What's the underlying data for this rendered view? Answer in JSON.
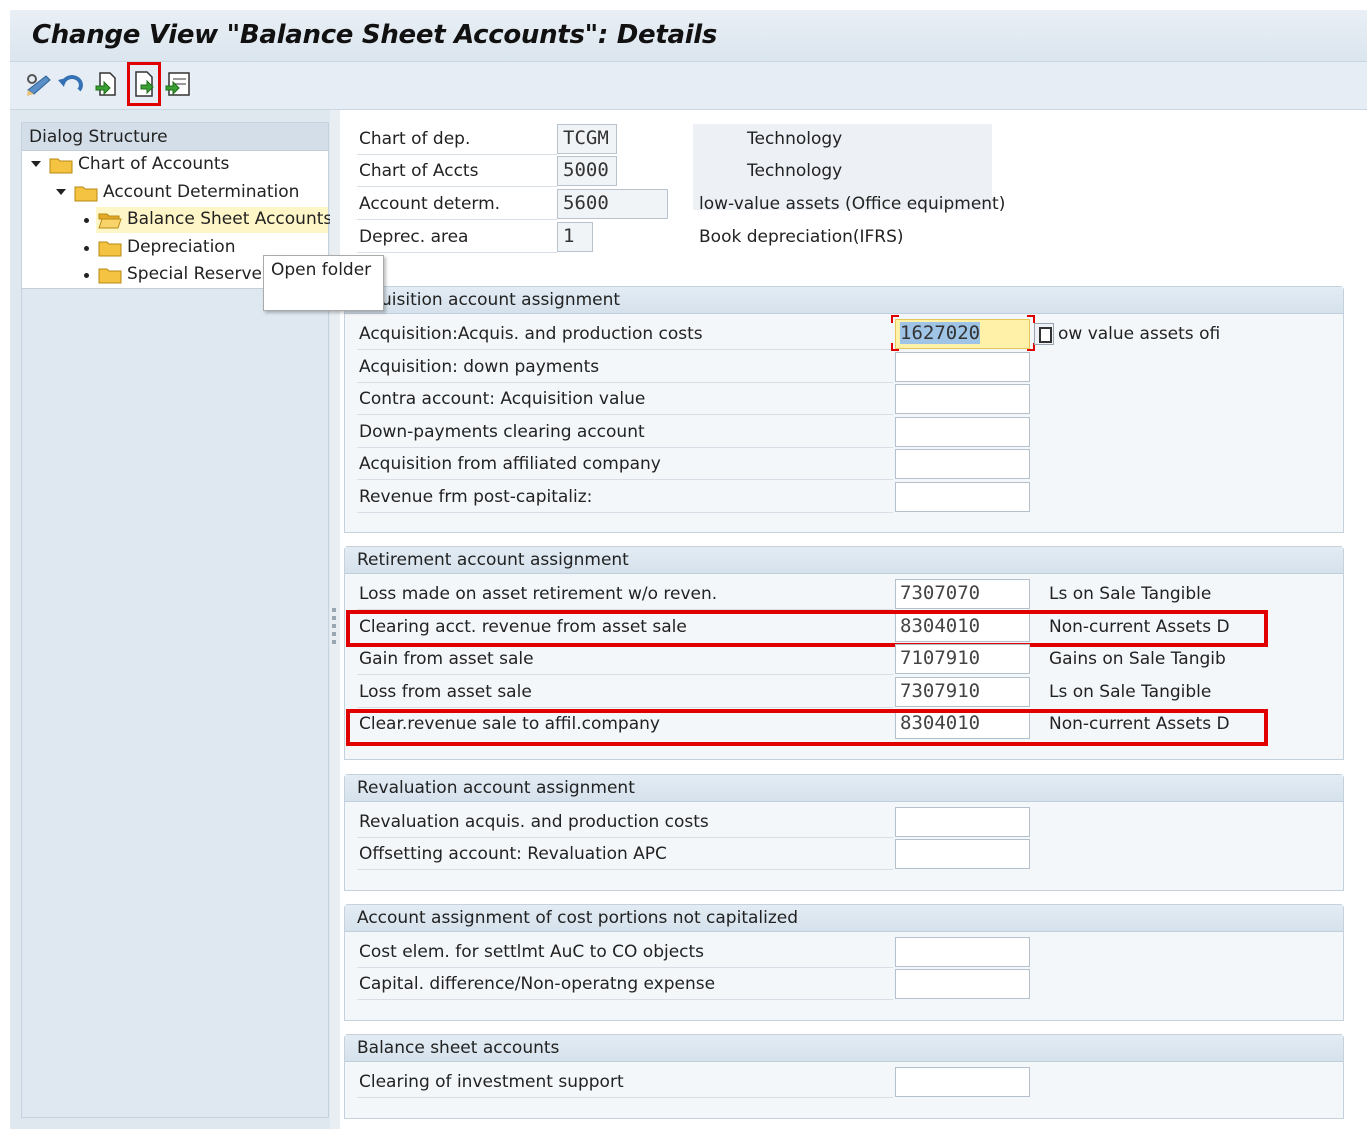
{
  "window": {
    "title": "Change View \"Balance Sheet Accounts\": Details"
  },
  "toolbar": {
    "icons": [
      "display-change-icon",
      "undo-icon",
      "new-entries-icon",
      "next-entry-icon",
      "copy-entry-icon"
    ],
    "highlighted_icon": "next-entry-icon"
  },
  "dialog_structure": {
    "title": "Dialog Structure",
    "items": [
      {
        "label": "Chart of Accounts",
        "level": 0,
        "expanded": true
      },
      {
        "label": "Account Determination",
        "level": 1,
        "expanded": true
      },
      {
        "label": "Balance Sheet Accounts",
        "level": 2,
        "selected": true
      },
      {
        "label": "Depreciation",
        "level": 2
      },
      {
        "label": "Special Reserves",
        "level": 2
      }
    ],
    "tooltip": "Open folder"
  },
  "header": {
    "chart_of_dep": {
      "label": "Chart of dep.",
      "value": "TCGM",
      "description": "Technology"
    },
    "chart_of_accts": {
      "label": "Chart of Accts",
      "value": "5000",
      "description": "Technology"
    },
    "account_determ": {
      "label": "Account determ.",
      "value": "5600",
      "description": "low-value assets (Office equipment)"
    },
    "deprec_area": {
      "label": "Deprec. area",
      "value": "1",
      "description": "Book depreciation(IFRS)"
    }
  },
  "acquisition": {
    "title": "Acquisition account assignment",
    "visible_title": "uisition account assignment",
    "rows": [
      {
        "label": "Acquisition:Acquis. and production costs",
        "value": "1627020",
        "description": "Low value assets ofi",
        "visible_description": "ow value assets ofi"
      },
      {
        "label": "Acquisition: down payments",
        "value": "",
        "description": ""
      },
      {
        "label": "Contra account: Acquisition value",
        "value": "",
        "description": ""
      },
      {
        "label": "Down-payments clearing account",
        "value": "",
        "description": ""
      },
      {
        "label": "Acquisition from affiliated company",
        "value": "",
        "description": ""
      },
      {
        "label": "Revenue frm post-capitaliz:",
        "value": "",
        "description": ""
      }
    ]
  },
  "retirement": {
    "title": "Retirement account assignment",
    "rows": [
      {
        "label": "Loss made on asset retirement w/o reven.",
        "value": "7307070",
        "description": "Ls on Sale Tangible"
      },
      {
        "label": "Clearing acct. revenue from asset sale",
        "value": "8304010",
        "description": "Non-current Assets D"
      },
      {
        "label": "Gain from asset sale",
        "value": "7107910",
        "description": "Gains on Sale Tangib"
      },
      {
        "label": "Loss from asset sale",
        "value": "7307910",
        "description": "Ls on Sale Tangible"
      },
      {
        "label": "Clear.revenue sale to affil.company",
        "value": "8304010",
        "description": "Non-current Assets D"
      }
    ]
  },
  "revaluation": {
    "title": "Revaluation account assignment",
    "rows": [
      {
        "label": "Revaluation acquis. and production costs",
        "value": ""
      },
      {
        "label": "Offsetting account: Revaluation APC",
        "value": ""
      }
    ]
  },
  "cost_portions": {
    "title": "Account assignment of cost portions not capitalized",
    "rows": [
      {
        "label": "Cost elem. for settlmt AuC to CO objects",
        "value": ""
      },
      {
        "label": "Capital. difference/Non-operatng expense",
        "value": ""
      }
    ]
  },
  "balance_sheet": {
    "title": "Balance sheet accounts",
    "rows": [
      {
        "label": "Clearing of investment support",
        "value": ""
      }
    ]
  },
  "colors": {
    "highlight": "#e10000",
    "focus_field": "#fff2a8",
    "tree_selected": "#fff6c8"
  }
}
